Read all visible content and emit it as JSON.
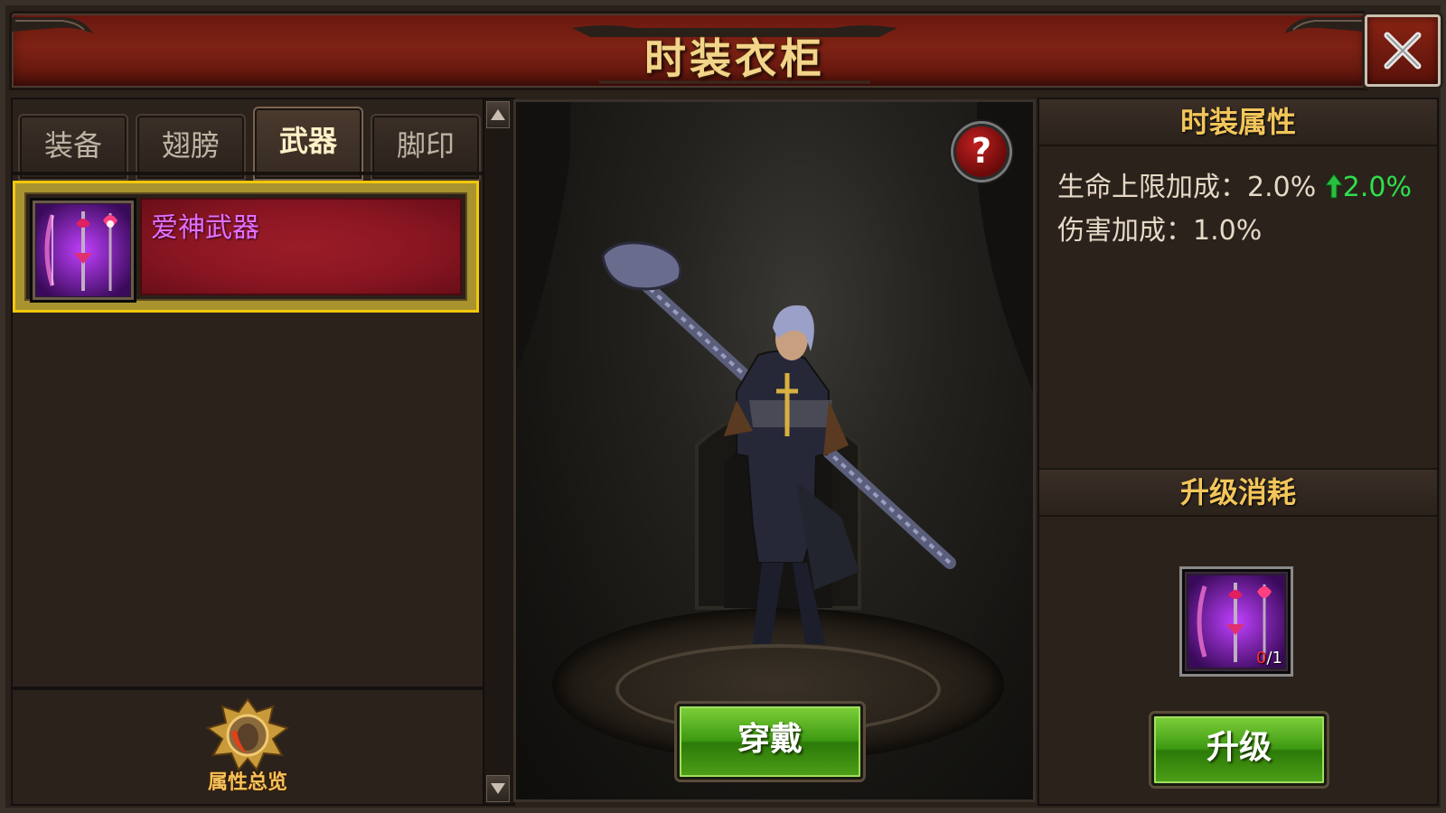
{
  "window": {
    "title": "时装衣柜"
  },
  "tabs": [
    {
      "label": "装备",
      "active": false
    },
    {
      "label": "翅膀",
      "active": false
    },
    {
      "label": "武器",
      "active": true
    },
    {
      "label": "脚印",
      "active": false
    }
  ],
  "list": {
    "items": [
      {
        "name": "爱神武器",
        "selected": true,
        "icon": "cupid-weapon-icon"
      }
    ]
  },
  "overview": {
    "label": "属性总览",
    "icon": "attribute-overview-emblem"
  },
  "preview": {
    "help_icon": "?",
    "wear_label": "穿戴"
  },
  "attributes": {
    "header": "时装属性",
    "stats": [
      {
        "label": "生命上限加成：2.0%",
        "increase": "2.0%",
        "increase_icon": "up-arrow-icon"
      },
      {
        "label": "伤害加成：1.0%"
      }
    ]
  },
  "upgrade": {
    "header": "升级消耗",
    "material": {
      "icon": "cupid-weapon-icon",
      "have": "0",
      "need": "/1"
    },
    "button_label": "升级"
  },
  "colors": {
    "title_gold": "#f2d58a",
    "section_gold": "#f3c65a",
    "item_purple": "#e070ff",
    "up_green": "#2ee04a",
    "button_green": "#3e9a12",
    "selection_yellow": "#f3c80a"
  }
}
